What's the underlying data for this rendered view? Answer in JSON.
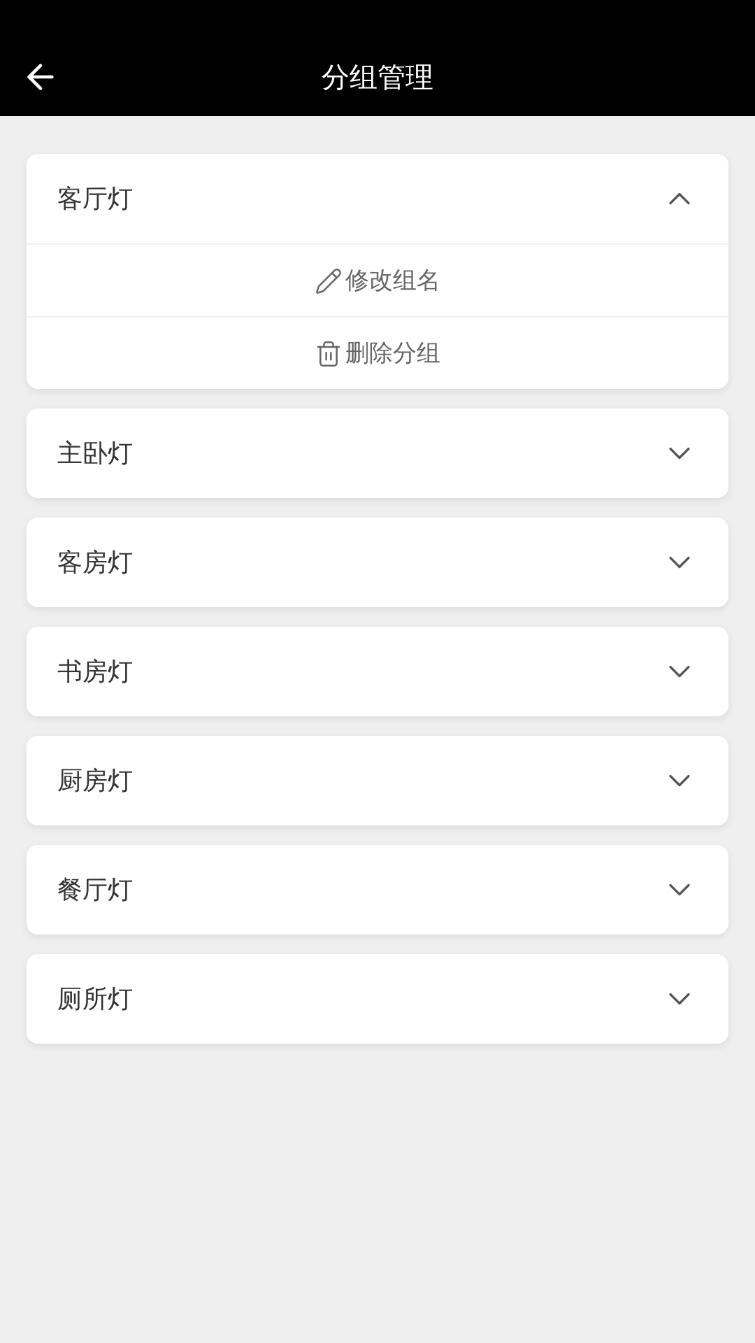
{
  "header": {
    "title": "分组管理"
  },
  "groups": [
    {
      "name": "客厅灯",
      "expanded": true,
      "actions": [
        {
          "kind": "edit",
          "label": "修改组名"
        },
        {
          "kind": "delete",
          "label": "删除分组"
        }
      ]
    },
    {
      "name": "主卧灯",
      "expanded": false
    },
    {
      "name": "客房灯",
      "expanded": false
    },
    {
      "name": "书房灯",
      "expanded": false
    },
    {
      "name": "厨房灯",
      "expanded": false
    },
    {
      "name": "餐厅灯",
      "expanded": false
    },
    {
      "name": "厕所灯",
      "expanded": false
    }
  ]
}
